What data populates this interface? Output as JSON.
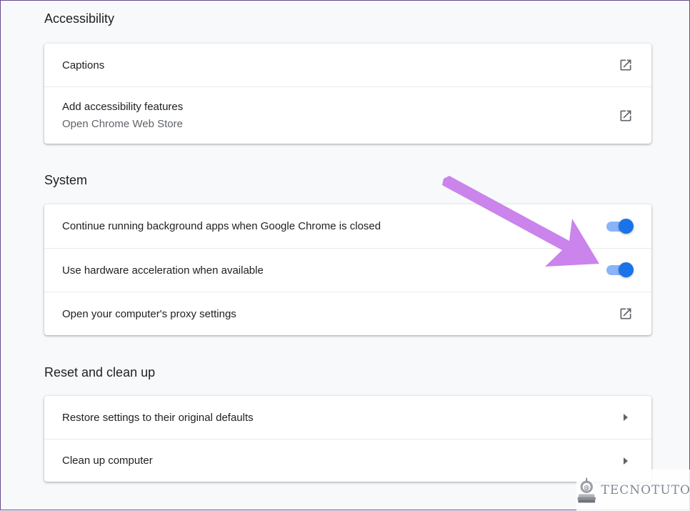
{
  "sections": {
    "accessibility": {
      "title": "Accessibility",
      "items": [
        {
          "label": "Captions",
          "icon": "open-external-icon"
        },
        {
          "label": "Add accessibility features",
          "sublabel": "Open Chrome Web Store",
          "icon": "open-external-icon"
        }
      ]
    },
    "system": {
      "title": "System",
      "items": [
        {
          "label": "Continue running background apps when Google Chrome is closed",
          "toggle_on": true
        },
        {
          "label": "Use hardware acceleration when available",
          "toggle_on": true
        },
        {
          "label": "Open your computer's proxy settings",
          "icon": "open-external-icon"
        }
      ]
    },
    "reset": {
      "title": "Reset and clean up",
      "items": [
        {
          "label": "Restore settings to their original defaults",
          "icon": "chevron-right-icon"
        },
        {
          "label": "Clean up computer",
          "icon": "chevron-right-icon"
        }
      ]
    }
  },
  "watermark": {
    "text": "TECNOTUTO"
  },
  "colors": {
    "accent": "#1a73e8",
    "toggle_track": "#8ab4f8",
    "annotation_arrow": "#c77dea",
    "icon": "#5f6368"
  }
}
